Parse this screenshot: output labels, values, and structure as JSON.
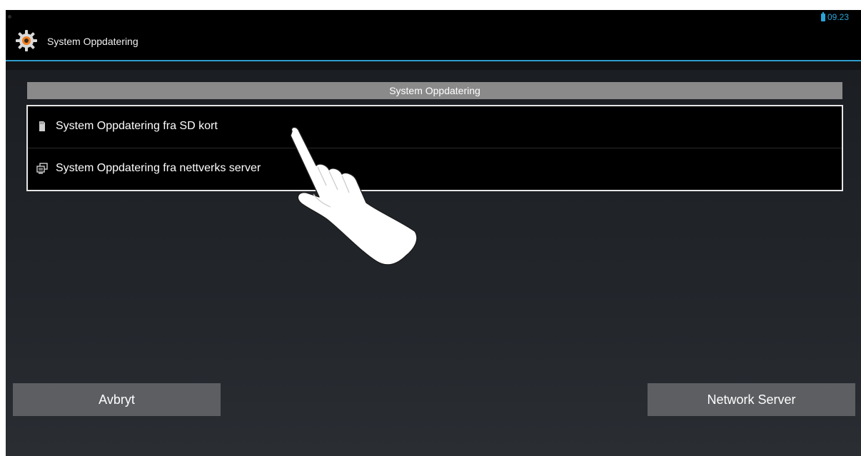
{
  "status_bar": {
    "time": "09.23",
    "icons": [
      "notification-dot-icon",
      "battery-icon"
    ],
    "accent_color": "#2aa4d8"
  },
  "action_bar": {
    "title": "System Oppdatering",
    "icon": "settings-gear-icon",
    "divider_color": "#2e9ccc"
  },
  "list": {
    "header": "System Oppdatering",
    "items": [
      {
        "label": "System Oppdatering fra SD kort",
        "icon": "sd-card-icon"
      },
      {
        "label": "System Oppdatering fra nettverks server",
        "icon": "network-computers-icon"
      }
    ]
  },
  "buttons": {
    "cancel_label": "Avbryt",
    "network_label": "Network Server",
    "button_color": "#5c5e62"
  },
  "overlay": {
    "icon": "hand-pointer-icon"
  }
}
